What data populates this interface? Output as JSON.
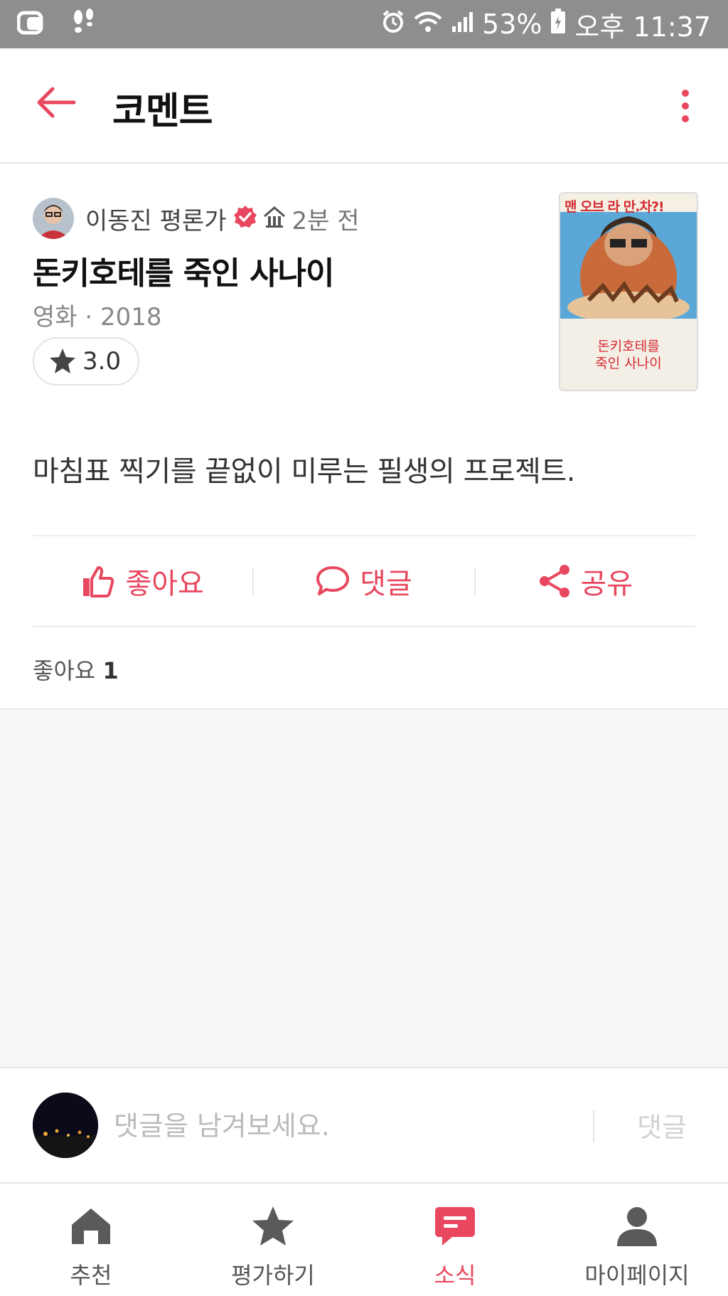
{
  "status_bar": {
    "battery": "53%",
    "time": "오후 11:37"
  },
  "header": {
    "title": "코멘트"
  },
  "post": {
    "author_name": "이동진 평론가",
    "time_ago": "2분 전",
    "movie_title": "돈키호테를 죽인 사나이",
    "meta": "영화 · 2018",
    "rating": "3.0",
    "poster": {
      "tagline": "맨 오브 라 만.차?!",
      "title_line1": "돈키호테를",
      "title_line2": "죽인 사나이"
    },
    "comment": "마침표 찍기를 끝없이 미루는 필생의 프로젝트.",
    "actions": {
      "like": "좋아요",
      "reply": "댓글",
      "share": "공유"
    },
    "likes_label": "좋아요",
    "likes_count": "1"
  },
  "composer": {
    "placeholder": "댓글을 남겨보세요.",
    "submit": "댓글"
  },
  "bottom_nav": [
    {
      "label": "추천",
      "icon": "home-icon"
    },
    {
      "label": "평가하기",
      "icon": "star-icon"
    },
    {
      "label": "소식",
      "icon": "chat-icon",
      "active": true
    },
    {
      "label": "마이페이지",
      "icon": "person-icon"
    }
  ],
  "colors": {
    "accent": "#e8475f",
    "status_bar": "#8e8e8e",
    "background": "#f7f7f7"
  }
}
